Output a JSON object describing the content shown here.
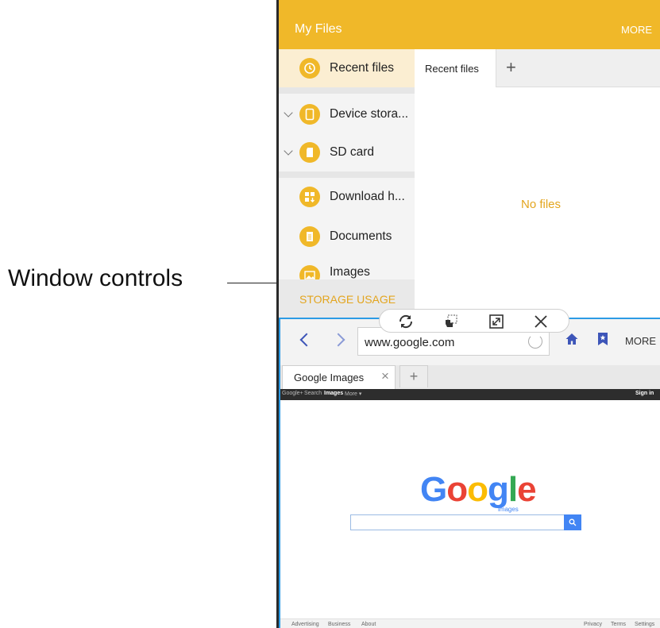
{
  "callout": {
    "label": "Window controls"
  },
  "my_files": {
    "title": "My Files",
    "more": "MORE",
    "sidebar": {
      "recent": "Recent files",
      "device": "Device stora...",
      "sd": "SD card",
      "download": "Download h...",
      "documents": "Documents",
      "images": "Images",
      "storage_usage": "STORAGE USAGE"
    },
    "tab_label": "Recent files",
    "tab_add": "+",
    "empty_text": "No files"
  },
  "window_controls": {
    "icons": [
      "switch-windows-icon",
      "drag-and-drop-icon",
      "maximize-icon",
      "close-icon"
    ]
  },
  "browser": {
    "url": "www.google.com",
    "more": "MORE",
    "tab_title": "Google Images",
    "tab_close": "×",
    "tab_add": "+",
    "google_bar": {
      "left_links": [
        "Google+",
        "Search",
        "Images",
        "More ▾"
      ],
      "sign_in": "Sign in"
    },
    "logo": {
      "text": "Google",
      "sub": "images"
    },
    "footer": {
      "left_links": [
        "Advertising",
        "Business",
        "About"
      ],
      "right_links": [
        "Privacy",
        "Terms",
        "Settings"
      ]
    }
  },
  "colors": {
    "my_files_accent": "#f0b829",
    "browser_accent": "#2c9be5",
    "browser_icons": "#3d55b8"
  }
}
